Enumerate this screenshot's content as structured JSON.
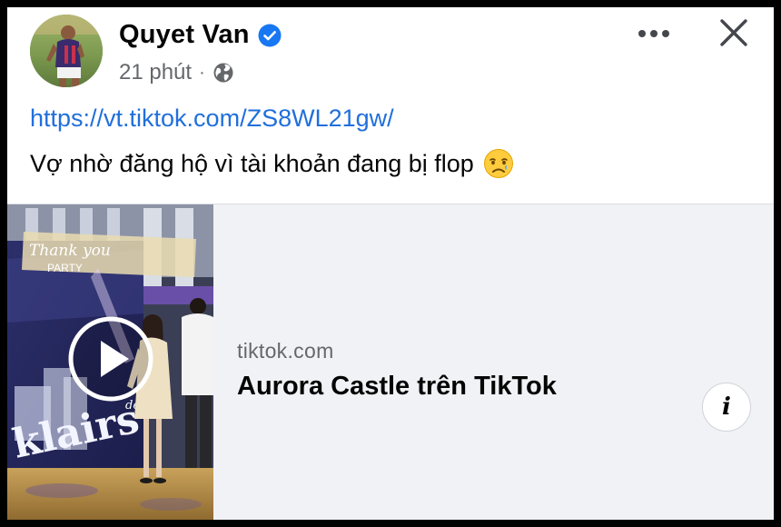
{
  "post": {
    "author": "Quyet Van",
    "time": "21 phút",
    "separator": "·",
    "link_text": "https://vt.tiktok.com/ZS8WL21gw/",
    "caption": "Vợ nhờ đăng hộ vì tài khoản đang bị flop",
    "caption_emoji": "crying-face-emoji"
  },
  "link_preview": {
    "domain": "tiktok.com",
    "title": "Aurora Castle trên TikTok",
    "info_label": "i",
    "thumbnail_texts": {
      "sign_script": "Thank you",
      "sign_sub": "PARTY",
      "brand_small": "dear,",
      "brand": "klairs"
    }
  },
  "icons": {
    "verified": "verified-badge-icon",
    "audience": "globe-icon",
    "more": "more-options-icon",
    "close": "close-icon",
    "play": "play-icon",
    "info": "info-icon"
  },
  "colors": {
    "link": "#216fdb",
    "verified": "#1877f2",
    "secondary_text": "#65676b",
    "preview_bg": "#f0f2f5"
  }
}
